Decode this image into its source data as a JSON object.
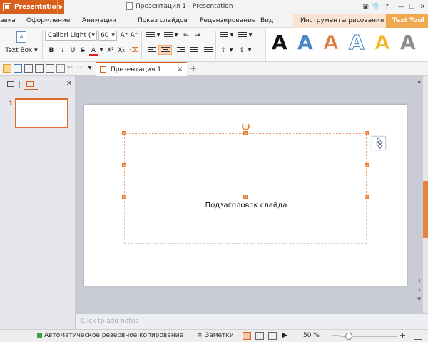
{
  "app": {
    "name": "Presentation",
    "window_title": "Презентация 1 - Presentation"
  },
  "tabs": [
    {
      "label": "авка"
    },
    {
      "label": "Оформление"
    },
    {
      "label": "Анимация"
    },
    {
      "label": "Показ слайдов"
    },
    {
      "label": "Рецензирование"
    },
    {
      "label": "Вид"
    },
    {
      "label": "Инструменты рисования"
    },
    {
      "label": "Text Tool"
    }
  ],
  "ribbon": {
    "text_box_label": "Text Box",
    "font_name": "Calibri Light (",
    "font_size": "60",
    "format_buttons": {
      "bold": "B",
      "italic": "I",
      "underline": "U",
      "strike": "S",
      "color": "A",
      "superscript": "X²",
      "subscript": "X₂"
    },
    "grow_font": "A⁺",
    "shrink_font": "A⁻",
    "word_art_glyph": "A",
    "word_art_colors": [
      "#111111",
      "#4a86c8",
      "#e07a3c",
      "#4a86c8",
      "#f3b524",
      "#8c8c8c"
    ]
  },
  "doc_tab": {
    "label": "Презентация 1"
  },
  "pane": {
    "slide_number": "1"
  },
  "slide": {
    "subtitle_placeholder": "Подзаголовок слайда"
  },
  "notes": {
    "placeholder": "Click to add notes"
  },
  "status": {
    "backup_text": "Автоматическое резервное копирование",
    "notes_label": "Заметки",
    "zoom": "50 %"
  },
  "colors": {
    "accent": "#d9601a",
    "text_tool_tab": "#f0a84e",
    "drawing_tab": "#fbe3d3"
  }
}
